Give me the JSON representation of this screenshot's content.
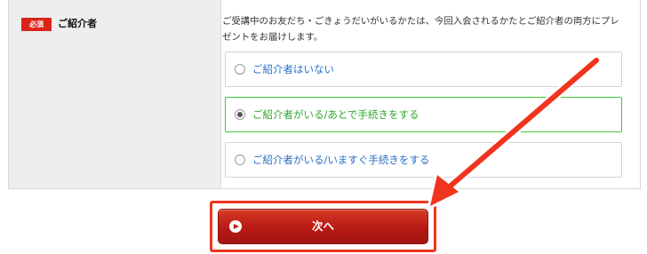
{
  "field": {
    "required_badge": "必須",
    "label": "ご紹介者",
    "help_text": "ご受講中のお友だち・ごきょうだいがいるかたは、今回入会されるかたとご紹介者の両方にプレゼントをお届けします。"
  },
  "options": [
    {
      "label": "ご紹介者はいない",
      "selected": false
    },
    {
      "label": "ご紹介者がいる/あとで手続きをする",
      "selected": true
    },
    {
      "label": "ご紹介者がいる/いますぐ手続きをする",
      "selected": false
    }
  ],
  "next_button": {
    "label": "次へ",
    "icon": "play-icon"
  },
  "annotation": {
    "highlight_color": "#f0341e",
    "icon": "arrow-icon"
  },
  "colors": {
    "accent_red": "#c21d15",
    "selected_green": "#41c532",
    "link_blue": "#2a6fc9"
  }
}
